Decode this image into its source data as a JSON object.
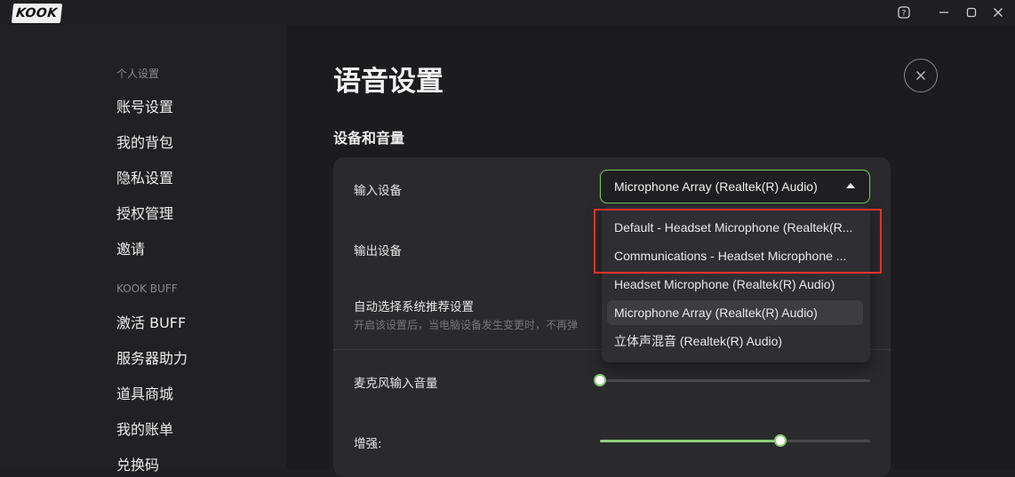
{
  "app": {
    "logo": "KOOK"
  },
  "window_controls": {
    "help": "?",
    "minimize": "—",
    "maximize": "▢",
    "close": "✕"
  },
  "sidebar": {
    "sections": [
      {
        "title": "个人设置",
        "items": [
          "账号设置",
          "我的背包",
          "隐私设置",
          "授权管理",
          "邀请"
        ]
      },
      {
        "title": "KOOK BUFF",
        "items": [
          "激活 BUFF",
          "服务器助力",
          "道具商城",
          "我的账单",
          "兑换码"
        ]
      }
    ]
  },
  "main": {
    "title": "语音设置",
    "section_title": "设备和音量",
    "input_device": {
      "label": "输入设备",
      "selected": "Microphone Array (Realtek(R) Audio)",
      "options": [
        "Default - Headset Microphone (Realtek(R...",
        "Communications - Headset Microphone ...",
        "Headset Microphone (Realtek(R) Audio)",
        "Microphone Array (Realtek(R) Audio)",
        "立体声混音 (Realtek(R) Audio)"
      ]
    },
    "output_device": {
      "label": "输出设备"
    },
    "auto_select": {
      "label": "自动选择系统推荐设置",
      "description": "开启该设置后，当电脑设备发生变更时，不再弹"
    },
    "mic_volume": {
      "label": "麦克风输入音量",
      "value": 0
    },
    "boost": {
      "label": "增强:",
      "value": 0.67
    }
  },
  "colors": {
    "accent": "#8bd07a",
    "highlight_box": "#e0322d",
    "background": "#1c1c1e"
  },
  "icons": {
    "close": "close-icon",
    "dropdown": "caret-up-icon"
  }
}
